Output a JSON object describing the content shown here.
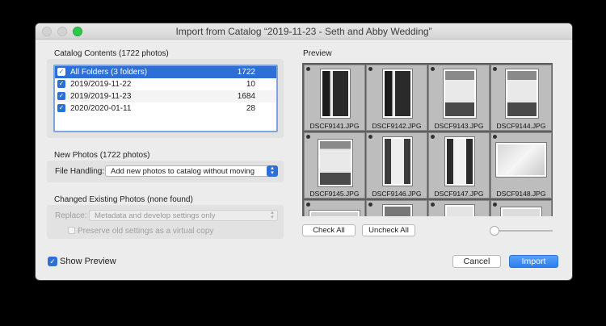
{
  "window": {
    "title": "Import from Catalog “2019-11-23 - Seth and Abby Wedding”"
  },
  "catalog": {
    "heading": "Catalog Contents (1722 photos)",
    "rows": [
      {
        "name": "All Folders (3 folders)",
        "count": "1722",
        "checked": true
      },
      {
        "name": "2019/2019-11-22",
        "count": "10",
        "checked": true
      },
      {
        "name": "2019/2019-11-23",
        "count": "1684",
        "checked": true
      },
      {
        "name": "2020/2020-01-11",
        "count": "28",
        "checked": true
      }
    ]
  },
  "new_photos": {
    "heading": "New Photos (1722 photos)",
    "file_handling_label": "File Handling:",
    "file_handling_value": "Add new photos to catalog without moving"
  },
  "changed": {
    "heading": "Changed Existing Photos (none found)",
    "replace_label": "Replace:",
    "replace_value": "Metadata and develop settings only",
    "preserve_label": "Preserve old settings as a virtual copy"
  },
  "preview": {
    "heading": "Preview",
    "files": [
      "DSCF9141.JPG",
      "DSCF9142.JPG",
      "DSCF9143.JPG",
      "DSCF9144.JPG",
      "DSCF9145.JPG",
      "DSCF9146.JPG",
      "DSCF9147.JPG",
      "DSCF9148.JPG"
    ],
    "check_all": "Check All",
    "uncheck_all": "Uncheck All",
    "thumb_size": 0.05
  },
  "footer": {
    "show_preview": "Show Preview",
    "cancel": "Cancel",
    "import": "Import"
  },
  "colors": {
    "accent": "#2d6fd6",
    "primary_button": "#2c7ef0",
    "close_traffic": "#2ec84a"
  }
}
